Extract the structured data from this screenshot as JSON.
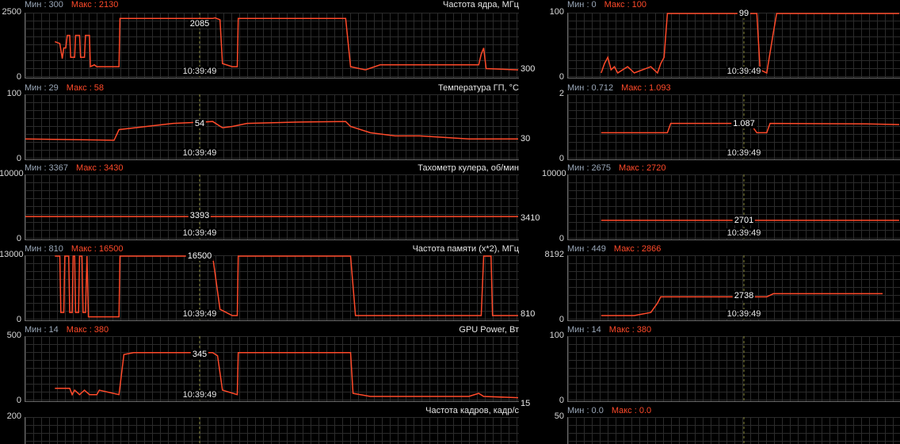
{
  "cursor_time": "10:39:49",
  "left": [
    {
      "title": "Частота ядра, МГц",
      "min": "Мин : 300",
      "max": "Макс : 2130",
      "ymax": "2500",
      "ymin": "0",
      "cursor_value": "2085",
      "current": "300"
    },
    {
      "title": "Температура ГП, °C",
      "min": "Мин : 29",
      "max": "Макс : 58",
      "ymax": "100",
      "ymin": "0",
      "cursor_value": "54",
      "current": "30"
    },
    {
      "title": "Тахометр кулера, об/мин",
      "min": "Мин : 3367",
      "max": "Макс : 3430",
      "ymax": "10000",
      "ymin": "0",
      "cursor_value": "3393",
      "current": "3410"
    },
    {
      "title": "Частота памяти (x*2), МГц",
      "min": "Мин : 810",
      "max": "Макс : 16500",
      "ymax": "13000",
      "ymin": "0",
      "cursor_value": "16500",
      "current": "810"
    },
    {
      "title": "GPU Power, Вт",
      "min": "Мин : 14",
      "max": "Макс : 380",
      "ymax": "500",
      "ymin": "0",
      "cursor_value": "345",
      "current": "15"
    },
    {
      "title": "Частота кадров, кадр/с",
      "min": "",
      "max": "",
      "ymax": "200",
      "ymin": "",
      "cursor_value": "",
      "current": ""
    }
  ],
  "right": [
    {
      "min": "Мин : 0",
      "max": "Макс : 100",
      "ymax": "100",
      "ymin": "0",
      "cursor_value": "99"
    },
    {
      "min": "Мин : 0.712",
      "max": "Макс : 1.093",
      "ymax": "2",
      "ymin": "0",
      "cursor_value": "1.087"
    },
    {
      "min": "Мин : 2675",
      "max": "Макс : 2720",
      "ymax": "10000",
      "ymin": "0",
      "cursor_value": "2701"
    },
    {
      "min": "Мин : 449",
      "max": "Макс : 2866",
      "ymax": "8192",
      "ymin": "0",
      "cursor_value": "2738"
    },
    {
      "min": "Мин : 14",
      "max": "Макс : 380",
      "ymax": "100",
      "ymin": "0",
      "cursor_value": ""
    },
    {
      "min": "Мин : 0.0",
      "max": "Макс : 0.0",
      "ymax": "50",
      "ymin": "",
      "cursor_value": ""
    }
  ],
  "colors": {
    "trace": "#ff4a2a",
    "min": "#9aa7b8",
    "max": "#ff4a2a",
    "cursor": "#8a8a3a",
    "grid": "#2b2b2b"
  }
}
